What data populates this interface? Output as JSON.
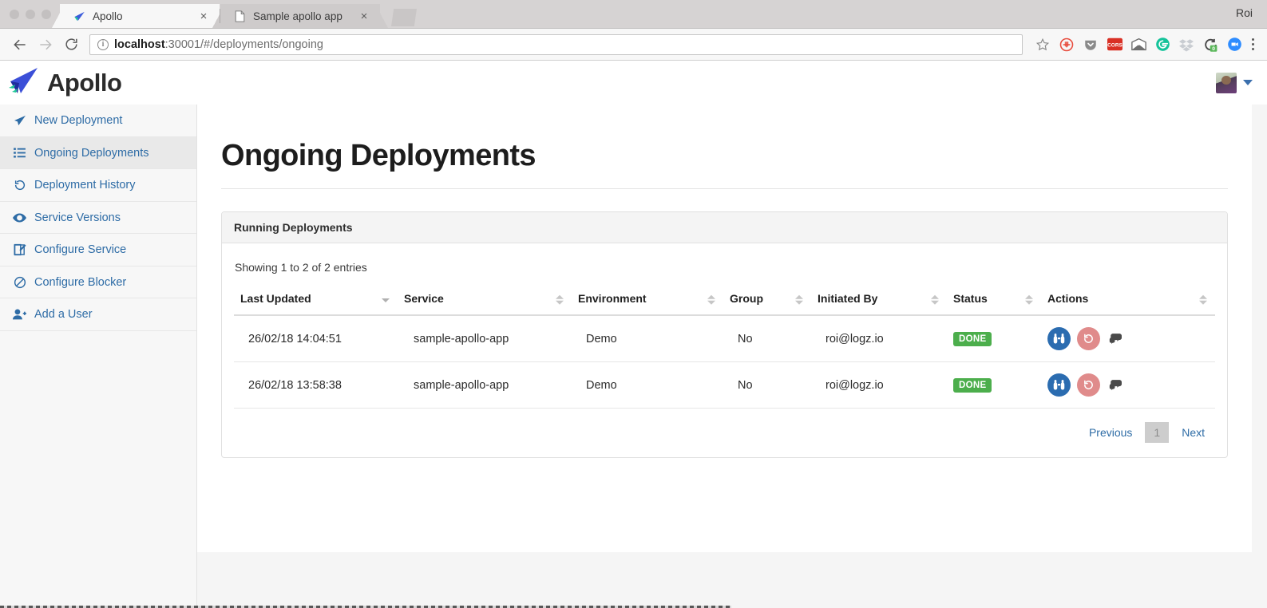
{
  "browser": {
    "window_user": "Roi",
    "tabs": [
      {
        "title": "Apollo",
        "favicon": "apollo-logo-icon",
        "active": true,
        "close_label": "×"
      },
      {
        "title": "Sample apollo app",
        "favicon": "page-icon",
        "active": false,
        "close_label": "×"
      }
    ],
    "nav": {
      "back": "back-arrow",
      "forward": "forward-arrow",
      "reload": "reload-arrow"
    },
    "url": {
      "scheme_info": "site-info-icon",
      "host": "localhost",
      "path": ":30001/#/deployments/ongoing",
      "full": "localhost:30001/#/deployments/ongoing"
    },
    "extensions": [
      {
        "name": "bookmark-star-icon",
        "color": "#8a8a8a"
      },
      {
        "name": "adblock-icon",
        "color": "#e84c3d"
      },
      {
        "name": "pocket-icon",
        "color": "#8a8a8a"
      },
      {
        "name": "cors-icon",
        "label": "CORS",
        "color": "#d93025"
      },
      {
        "name": "mail-icon",
        "color": "#6f6f6f"
      },
      {
        "name": "grammarly-icon",
        "color": "#15c39a"
      },
      {
        "name": "dropbox-icon",
        "color": "#c9cdd2"
      },
      {
        "name": "session-buddy-icon",
        "badge": "0",
        "color": "#4a4a4a",
        "badge_color": "#5cb85c"
      },
      {
        "name": "zoom-icon",
        "color": "#2d8cff"
      }
    ],
    "menu": "kebab-menu-icon"
  },
  "app": {
    "brand": {
      "name": "Apollo",
      "logo": "apollo-paper-plane-logo"
    },
    "user_menu": {
      "avatar": "user-avatar",
      "caret": "chevron-down-icon"
    }
  },
  "sidebar": {
    "items": [
      {
        "label": "New Deployment",
        "icon": "paper-plane-icon",
        "key": "new-deployment",
        "active": false
      },
      {
        "label": "Ongoing Deployments",
        "icon": "list-icon",
        "key": "ongoing-deployments",
        "active": true
      },
      {
        "label": "Deployment History",
        "icon": "history-icon",
        "key": "deployment-history",
        "active": false
      },
      {
        "label": "Service Versions",
        "icon": "eye-icon",
        "key": "service-versions",
        "active": false
      },
      {
        "label": "Configure Service",
        "icon": "edit-square-icon",
        "key": "configure-service",
        "active": false
      },
      {
        "label": "Configure Blocker",
        "icon": "ban-icon",
        "key": "configure-blocker",
        "active": false
      },
      {
        "label": "Add a User",
        "icon": "user-plus-icon",
        "key": "add-a-user",
        "active": false
      }
    ]
  },
  "main": {
    "page_title": "Ongoing Deployments",
    "panel_title": "Running Deployments",
    "table_info": "Showing 1 to 2 of 2 entries",
    "columns": [
      {
        "label": "Last Updated",
        "sort": "desc"
      },
      {
        "label": "Service",
        "sort": "none"
      },
      {
        "label": "Environment",
        "sort": "none"
      },
      {
        "label": "Group",
        "sort": "none"
      },
      {
        "label": "Initiated By",
        "sort": "none"
      },
      {
        "label": "Status",
        "sort": "none"
      },
      {
        "label": "Actions",
        "sort": "none"
      }
    ],
    "rows": [
      {
        "last_updated": "26/02/18 14:04:51",
        "service": "sample-apollo-app",
        "environment": "Demo",
        "group": "No",
        "initiated_by": "roi@logz.io",
        "status": "DONE",
        "actions": [
          "view-logs-binoculars-button",
          "rollback-undo-button",
          "comment-icon"
        ]
      },
      {
        "last_updated": "26/02/18 13:58:38",
        "service": "sample-apollo-app",
        "environment": "Demo",
        "group": "No",
        "initiated_by": "roi@logz.io",
        "status": "DONE",
        "actions": [
          "view-logs-binoculars-button",
          "rollback-undo-button",
          "comment-icon"
        ]
      }
    ],
    "pagination": {
      "previous": "Previous",
      "pages": [
        "1"
      ],
      "current": "1",
      "next": "Next"
    }
  },
  "colors": {
    "link_blue": "#2e6ca6",
    "status_green": "#4cae4c",
    "action_blue": "#2b6cb0",
    "action_red": "#e08b8b",
    "sidebar_bg": "#f7f7f7",
    "sidebar_active": "#e9e9e9"
  }
}
